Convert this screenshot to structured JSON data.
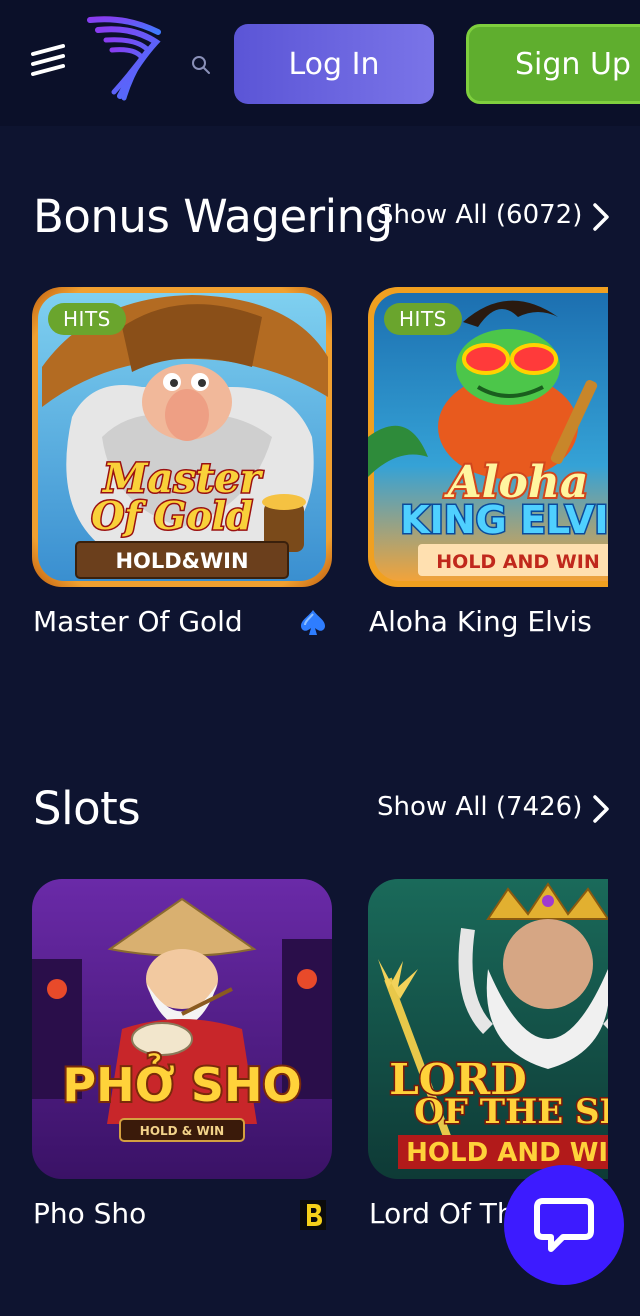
{
  "header": {
    "login_label": "Log In",
    "signup_label": "Sign Up"
  },
  "sections": [
    {
      "title": "Bonus Wagering",
      "show_all": "Show All (6072)",
      "games": [
        {
          "name": "Master Of Gold",
          "badge": "HITS",
          "art_title_1": "Master",
          "art_title_2": "Of Gold",
          "art_sub": "HOLD&WIN",
          "provider_icon": "spade-icon"
        },
        {
          "name": "Aloha King Elvis",
          "badge": "HITS",
          "art_title_1": "Aloha",
          "art_title_2": "KING ELVIS",
          "art_sub": "HOLD AND WIN"
        }
      ]
    },
    {
      "title": "Slots",
      "show_all": "Show All (7426)",
      "games": [
        {
          "name": "Pho Sho",
          "art_title_1": "PHỞ SHO",
          "art_sub": "HOLD & WIN",
          "provider_icon": "b-logo-icon"
        },
        {
          "name": "Lord Of Th",
          "art_title_1": "LORD",
          "art_title_2": "OF THE SEA",
          "art_sub": "HOLD AND WIN"
        }
      ]
    }
  ],
  "colors": {
    "background": "#0e1430",
    "header": "#0b1029",
    "login": "#6a64e0",
    "signup": "#5fae2e",
    "badge": "#6aa52d",
    "chat": "#3d1bff"
  }
}
